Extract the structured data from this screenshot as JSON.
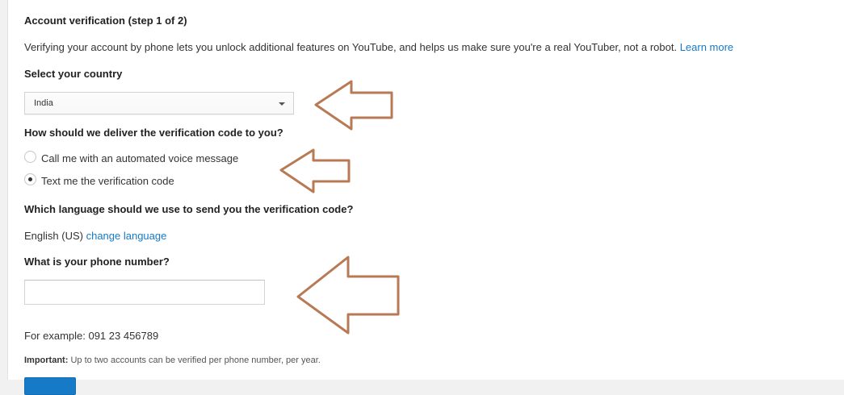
{
  "verification": {
    "title": "Account verification (step 1 of 2)",
    "description": "Verifying your account by phone lets you unlock additional features on YouTube, and helps us make sure you're a real YouTuber, not a robot.",
    "learn_more": "Learn more",
    "country_label": "Select your country",
    "country_value": "India",
    "delivery_label": "How should we deliver the verification code to you?",
    "delivery_options": [
      {
        "label": "Call me with an automated voice message",
        "selected": false
      },
      {
        "label": "Text me the verification code",
        "selected": true
      }
    ],
    "language_label": "Which language should we use to send you the verification code?",
    "language_value": "English (US)",
    "change_language": "change language",
    "phone_label": "What is your phone number?",
    "phone_value": "",
    "phone_example": "For example: 091 23 456789",
    "important_bold": "Important:",
    "important_text": " Up to two accounts can be verified per phone number, per year."
  },
  "annotation_color": "#b87a55",
  "accent_color": "#167ac6"
}
